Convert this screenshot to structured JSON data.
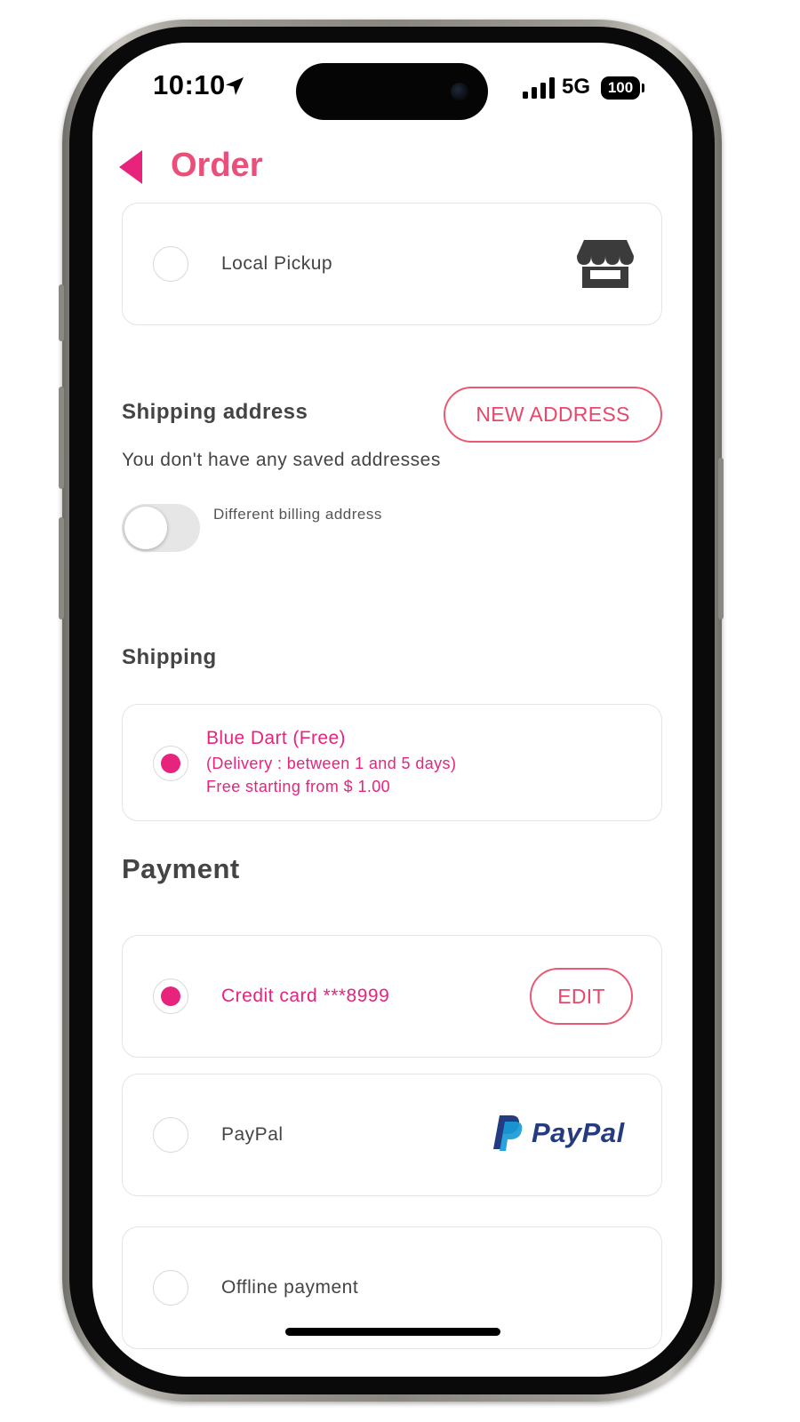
{
  "status_bar": {
    "time": "10:10",
    "network": "5G",
    "battery": "100"
  },
  "header": {
    "title": "Order",
    "accent_color": "#ea4f79"
  },
  "delivery_method": {
    "label": "Local Pickup",
    "selected": false,
    "icon": "store-icon"
  },
  "shipping_address": {
    "title": "Shipping address",
    "new_address_button": "NEW ADDRESS",
    "empty_message": "You don't have any saved addresses",
    "billing_toggle_label": "Different billing address",
    "billing_toggle_on": false
  },
  "shipping": {
    "title": "Shipping",
    "option": {
      "name": "Blue Dart (Free)",
      "delivery": "(Delivery : between 1 and 5 days)",
      "note": "Free starting from $ 1.00",
      "selected": true
    }
  },
  "payment": {
    "title": "Payment",
    "methods": [
      {
        "label": "Credit card ***8999",
        "selected": true,
        "action": "EDIT"
      },
      {
        "label": "PayPal",
        "selected": false,
        "logo_text": "PayPal"
      },
      {
        "label": "Offline payment",
        "selected": false
      }
    ]
  },
  "colors": {
    "selected": "#e8237c",
    "button_border": "#e85a73",
    "text": "#444444"
  }
}
